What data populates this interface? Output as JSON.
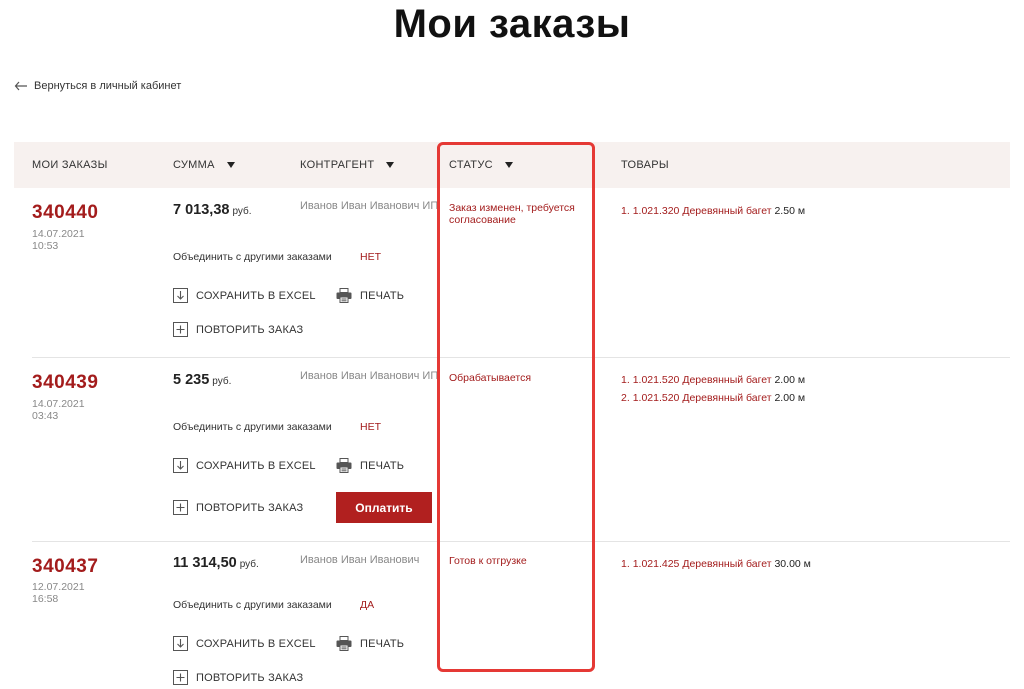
{
  "page": {
    "title": "Мои заказы",
    "back_link": "Вернуться в личный кабинет"
  },
  "table": {
    "headers": {
      "orders": "МОИ ЗАКАЗЫ",
      "sum": "СУММА",
      "contractor": "КОНТРАГЕНТ",
      "status": "СТАТУС",
      "goods": "ТОВАРЫ"
    }
  },
  "labels": {
    "merge": "Объединить с другими заказами",
    "save_excel": "СОХРАНИТЬ В EXCEL",
    "print": "ПЕЧАТЬ",
    "repeat": "ПОВТОРИТЬ ЗАКАЗ",
    "pay": "Оплатить",
    "currency": "руб."
  },
  "orders": [
    {
      "number": "340440",
      "date": "14.07.2021",
      "time": "10:53",
      "sum": "7 013,38",
      "contractor": "Иванов Иван Иванович ИП",
      "status": "Заказ изменен, требуется согласование",
      "merge": "НЕТ",
      "goods": [
        {
          "num": "1.",
          "code": "1.021.320",
          "name": "Деревянный багет",
          "qty": "2.50 м"
        }
      ]
    },
    {
      "number": "340439",
      "date": "14.07.2021",
      "time": "03:43",
      "sum": "5 235",
      "contractor": "Иванов Иван Иванович ИП",
      "status": "Обрабатывается",
      "merge": "НЕТ",
      "goods": [
        {
          "num": "1.",
          "code": "1.021.520",
          "name": "Деревянный багет",
          "qty": "2.00 м"
        },
        {
          "num": "2.",
          "code": "1.021.520",
          "name": "Деревянный багет",
          "qty": "2.00 м"
        }
      ]
    },
    {
      "number": "340437",
      "date": "12.07.2021",
      "time": "16:58",
      "sum": "11 314,50",
      "contractor": "Иванов Иван Иванович",
      "status": "Готов к отгрузке",
      "merge": "ДА",
      "goods": [
        {
          "num": "1.",
          "code": "1.021.425",
          "name": "Деревянный багет",
          "qty": "30.00 м"
        }
      ]
    }
  ],
  "colors": {
    "accent": "#a31c1c",
    "pay_button": "#b1201f",
    "header_bg": "#f7f1ef",
    "highlight": "#e53935"
  },
  "icons": {
    "back": "arrow-left-icon",
    "sort": "caret-down-icon",
    "excel": "download-icon",
    "print": "printer-icon",
    "repeat": "plus-box-icon"
  }
}
